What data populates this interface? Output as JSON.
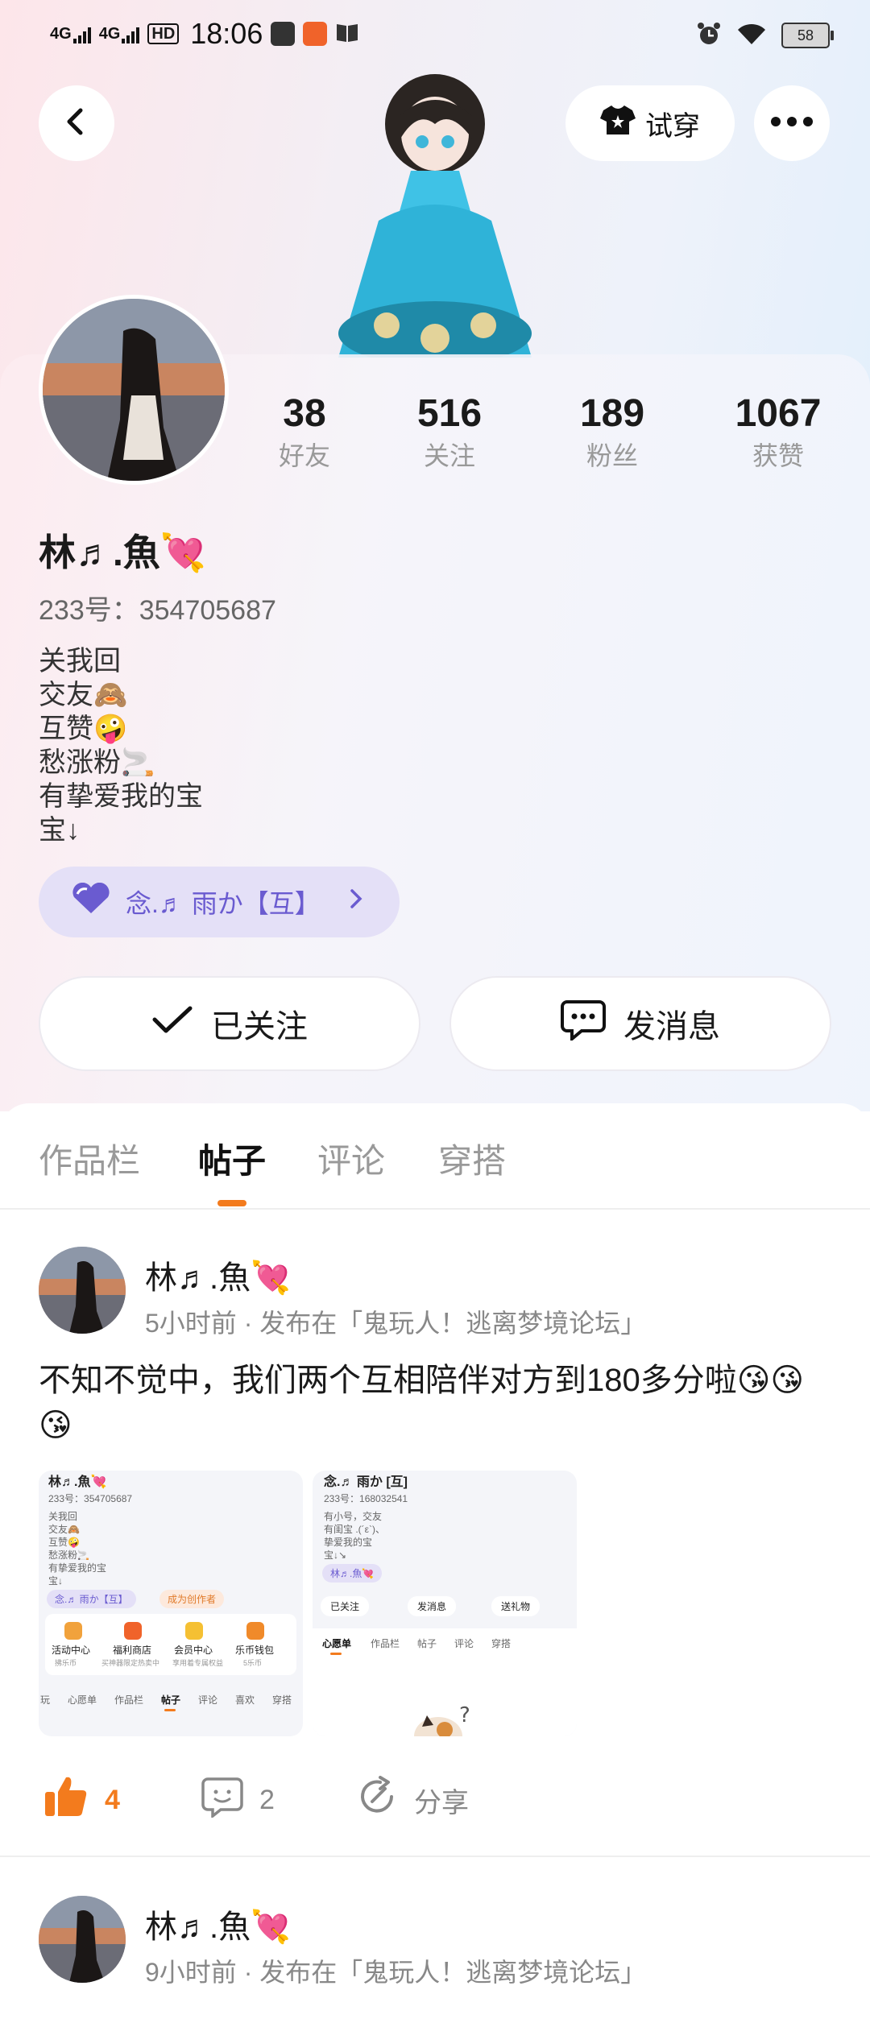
{
  "status_bar": {
    "net1": "4G",
    "net2": "4G",
    "hd": "HD",
    "time": "18:06",
    "battery": "58"
  },
  "header": {
    "tryon_label": "试穿",
    "back_icon": "chevron-left-icon",
    "more_icon": "ellipsis-icon"
  },
  "profile": {
    "stats": [
      {
        "value": "38",
        "label": "好友"
      },
      {
        "value": "516",
        "label": "关注"
      },
      {
        "value": "189",
        "label": "粉丝"
      },
      {
        "value": "1067",
        "label": "获赞"
      }
    ],
    "nickname": "林♬.魚💘",
    "uid": "233号：354705687",
    "bio": [
      "关我回",
      "交友🙈",
      "互赞🤪",
      "愁涨粉🚬",
      "有挚爱我的宝",
      "宝↓"
    ],
    "cp_name": "念.♬ 雨か【互】",
    "follow_label": "已关注",
    "message_label": "发消息"
  },
  "tabs": [
    {
      "label": "作品栏",
      "active": false
    },
    {
      "label": "帖子",
      "active": true
    },
    {
      "label": "评论",
      "active": false
    },
    {
      "label": "穿搭",
      "active": false
    }
  ],
  "posts": [
    {
      "author": "林♬.魚💘",
      "meta": "5小时前 · 发布在「鬼玩人！逃离梦境论坛」",
      "content": "不知不觉中，我们两个互相陪伴对方到180多分啦😘😘😘",
      "likes": "4",
      "comments": "2",
      "share_label": "分享",
      "image1": {
        "name": "林♬.魚💘",
        "uid": "233号：354705687",
        "bio": [
          "关我回",
          "交友🙈",
          "互赞🤪",
          "愁涨粉🚬",
          "有挚爱我的宝",
          "宝↓"
        ],
        "cp": "念.♬ 雨か【互】",
        "creator": "成为创作者",
        "icons": [
          "活动中心",
          "福利商店",
          "会员中心",
          "乐币钱包"
        ],
        "icon_subs": [
          "拂乐币",
          "买神器限定热卖中",
          "享用着专属权益",
          "5乐币"
        ],
        "tabs": [
          "玩",
          "心愿单",
          "作品栏",
          "帖子",
          "评论",
          "喜欢",
          "穿搭"
        ]
      },
      "image2": {
        "name": "念.♬ 雨か [互]",
        "uid": "233号：168032541",
        "bio": [
          "有小号，交友",
          "有闺宝 .(´ε`)、",
          "挚爱我的宝",
          "宝↓↘"
        ],
        "cp": "林♬.魚💘",
        "btns": [
          "已关注",
          "发消息",
          "送礼物"
        ],
        "tabs": [
          "心愿单",
          "作品栏",
          "帖子",
          "评论",
          "穿搭"
        ]
      }
    },
    {
      "author": "林♬.魚💘",
      "meta": "9小时前 · 发布在「鬼玩人！逃离梦境论坛」"
    }
  ],
  "colors": {
    "accent": "#f37b1d",
    "cp_pill": "#e4e0f7",
    "cp_text": "#6a5bd0"
  }
}
